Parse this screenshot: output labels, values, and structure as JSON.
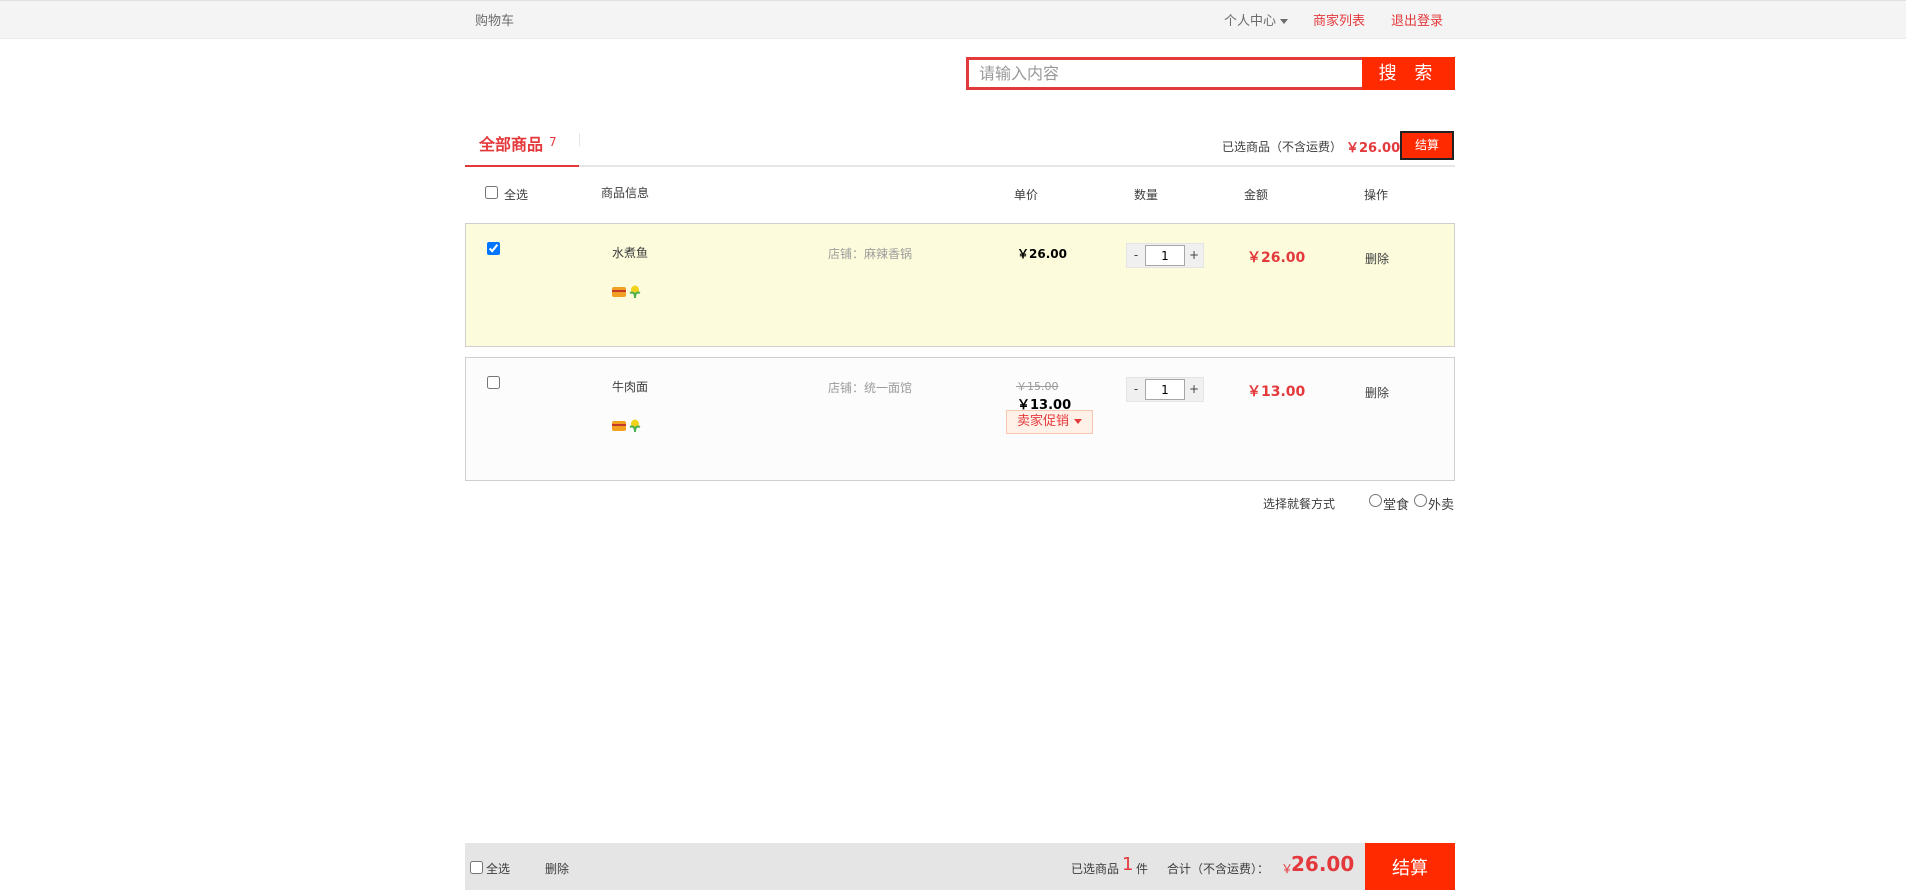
{
  "topbar": {
    "title": "购物车",
    "personal_center": "个人中心",
    "merchant_list": "商家列表",
    "logout": "退出登录"
  },
  "search": {
    "placeholder": "请输入内容",
    "button": "搜 索"
  },
  "tabs": {
    "all_label": "全部商品",
    "all_count": "7"
  },
  "summary_top": {
    "label": "已选商品（不含运费）",
    "price": "￥26.00",
    "checkout": "结算"
  },
  "header": {
    "select_all": "全选",
    "info": "商品信息",
    "unit_price": "单价",
    "quantity": "数量",
    "amount": "金额",
    "operation": "操作"
  },
  "items": [
    {
      "checked": true,
      "name": "水煮鱼",
      "shop": "店铺：麻辣香锅",
      "unit_price": "￥26.00",
      "quantity": "1",
      "amount": "￥26.00",
      "delete": "删除"
    },
    {
      "checked": false,
      "name": "牛肉面",
      "shop": "店铺：统一面馆",
      "old_price": "￥15.00",
      "unit_price": "￥13.00",
      "promo": "卖家促销",
      "quantity": "1",
      "amount": "￥13.00",
      "delete": "删除"
    }
  ],
  "dining": {
    "label": "选择就餐方式",
    "dine_in": "堂食",
    "takeout": "外卖"
  },
  "bottom": {
    "select_all": "全选",
    "delete": "删除",
    "selected_label": "已选商品",
    "selected_count": "1",
    "selected_unit": "件",
    "total_label": "合计（不含运费）：",
    "currency": "￥",
    "total_amount": "26.00",
    "checkout": "结算"
  },
  "colors": {
    "accent": "#e4393c",
    "button": "#ff2a00",
    "selected_row": "#fcfcdc"
  }
}
